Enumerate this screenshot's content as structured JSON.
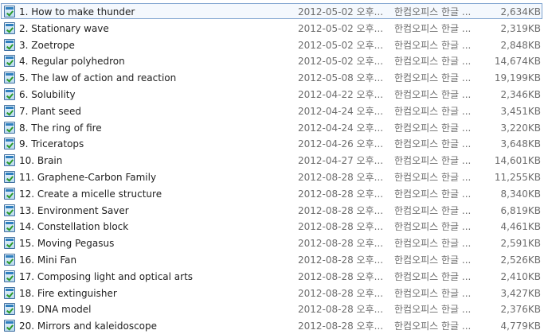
{
  "files": [
    {
      "name": "1. How to make thunder",
      "date": "2012-05-02 오후...",
      "type": "한컴오피스 한글 ...",
      "size": "2,634KB"
    },
    {
      "name": "2. Stationary wave",
      "date": "2012-05-02 오후...",
      "type": "한컴오피스 한글 ...",
      "size": "2,319KB"
    },
    {
      "name": "3. Zoetrope",
      "date": "2012-05-02 오후...",
      "type": "한컴오피스 한글 ...",
      "size": "2,848KB"
    },
    {
      "name": "4. Regular polyhedron",
      "date": "2012-05-02 오후...",
      "type": "한컴오피스 한글 ...",
      "size": "14,674KB"
    },
    {
      "name": "5. The law of action and reaction",
      "date": "2012-05-08 오후...",
      "type": "한컴오피스 한글 ...",
      "size": "19,199KB"
    },
    {
      "name": "6. Solubility",
      "date": "2012-04-22 오후...",
      "type": "한컴오피스 한글 ...",
      "size": "2,346KB"
    },
    {
      "name": "7. Plant seed",
      "date": "2012-04-24 오후...",
      "type": "한컴오피스 한글 ...",
      "size": "3,451KB"
    },
    {
      "name": "8. The ring of fire",
      "date": "2012-04-24 오후...",
      "type": "한컴오피스 한글 ...",
      "size": "3,220KB"
    },
    {
      "name": "9. Triceratops",
      "date": "2012-04-26 오후...",
      "type": "한컴오피스 한글 ...",
      "size": "3,648KB"
    },
    {
      "name": "10. Brain",
      "date": "2012-04-27 오후...",
      "type": "한컴오피스 한글 ...",
      "size": "14,601KB"
    },
    {
      "name": "11. Graphene-Carbon Family",
      "date": "2012-08-28 오후...",
      "type": "한컴오피스 한글 ...",
      "size": "11,255KB"
    },
    {
      "name": "12. Create a micelle structure",
      "date": "2012-08-28 오후...",
      "type": "한컴오피스 한글 ...",
      "size": "8,340KB"
    },
    {
      "name": "13. Environment Saver",
      "date": "2012-08-28 오후...",
      "type": "한컴오피스 한글 ...",
      "size": "6,819KB"
    },
    {
      "name": "14. Constellation block",
      "date": "2012-08-28 오후...",
      "type": "한컴오피스 한글 ...",
      "size": "4,461KB"
    },
    {
      "name": "15. Moving Pegasus",
      "date": "2012-08-28 오후...",
      "type": "한컴오피스 한글 ...",
      "size": "2,591KB"
    },
    {
      "name": "16. Mini Fan",
      "date": "2012-08-28 오후...",
      "type": "한컴오피스 한글 ...",
      "size": "2,526KB"
    },
    {
      "name": "17. Composing light and optical arts",
      "date": "2012-08-28 오후...",
      "type": "한컴오피스 한글 ...",
      "size": "2,410KB"
    },
    {
      "name": "18. Fire extinguisher",
      "date": "2012-08-28 오후...",
      "type": "한컴오피스 한글 ...",
      "size": "3,427KB"
    },
    {
      "name": "19. DNA model",
      "date": "2012-08-28 오후...",
      "type": "한컴오피스 한글 ...",
      "size": "2,376KB"
    },
    {
      "name": "20. Mirrors and kaleidoscope",
      "date": "2012-08-28 오후...",
      "type": "한컴오피스 한글 ...",
      "size": "4,779KB"
    }
  ],
  "icon": "hwp-document-icon",
  "selected_index": 0
}
